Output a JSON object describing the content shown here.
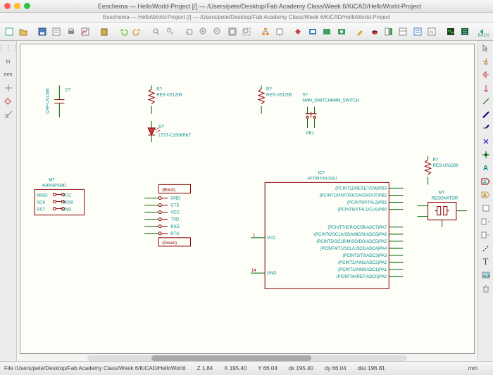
{
  "title": "Eeschema — HelloWorld-Project [/] — /Users/pete/Desktop/Fab Academy Class/Week 6/KiCAD/HelloWorld-Project",
  "subtitle": "Eeschema — HelloWorld-Project [/] — /Users/pete/Desktop/Fab Academy Class/Week 6/KiCAD/HelloWorld-Project",
  "left": {
    "grid": "⋮⋮",
    "in": "in",
    "mm": "mm"
  },
  "status": {
    "file": "File /Users/pete/Desktop/Fab Academy Class/Week 6/KiCAD/HelloWorld",
    "zoom": "Z 1.84",
    "x": "X 195.40",
    "y": "Y 66.04",
    "dx": "dx 195.40",
    "dy": "dy 66.04",
    "dist": "dist 196.81",
    "unit": "mm"
  },
  "components": {
    "c1": {
      "ref": "C?",
      "val": "CAP-US1206"
    },
    "r1": {
      "ref": "R?",
      "val": "RES-US1206"
    },
    "r2": {
      "ref": "R?",
      "val": "RES-US1206"
    },
    "r3": {
      "ref": "R?",
      "val": "RES-US1206"
    },
    "d1": {
      "ref": "D?",
      "val": "LTST-C150KRKT"
    },
    "sw": {
      "ref": "S?",
      "val": "6MM_SWITCH6MM_SWITCH",
      "pin": "PB1"
    },
    "conn": {
      "ref": "M?",
      "val": "AVRISPSMD",
      "pins": [
        "MISO",
        "SCK",
        "RST",
        "VCC",
        "MOSI",
        "GND"
      ]
    },
    "ftdi": {
      "label_top": "(Black)",
      "label_bot": "(Green)",
      "pins": [
        "GND",
        "CTS",
        "VCC",
        "TXD",
        "RXD",
        "RTS"
      ]
    },
    "ic": {
      "ref": "IC?",
      "val": "ATTINY44-SSU",
      "vcc": "VCC",
      "gnd": "GND",
      "pins_top": [
        "(PCINT11/RESET/DW)PB3",
        "(PCINT10/INT0/OC0A/CKOUT)PB2",
        "(PCINT9/XTAL2)PB1",
        "(PCINT8/XTAL1/CLK)PB0"
      ],
      "pins_bot": [
        "(PCINT7/ICP/OC0B/ADC7)PA7",
        "(PCINT6/OC1A/SDA/MOSI/ADC6)PA6",
        "(PCINT5/OC1B/MISO/DO/ADC5)PA5",
        "(PCINT4/T1/SCL/USCK/ADC4)PA4",
        "(PCINT3/T0/ADC3)PA3",
        "(PCINT2/AIN1/ADC2)PA2",
        "(PCINT1/AIN0/ADC1)PA1",
        "(PCINT0/AREF/ADC0)PA0"
      ]
    },
    "xtal": {
      "ref": "M?",
      "val": "RESONATOR"
    }
  }
}
